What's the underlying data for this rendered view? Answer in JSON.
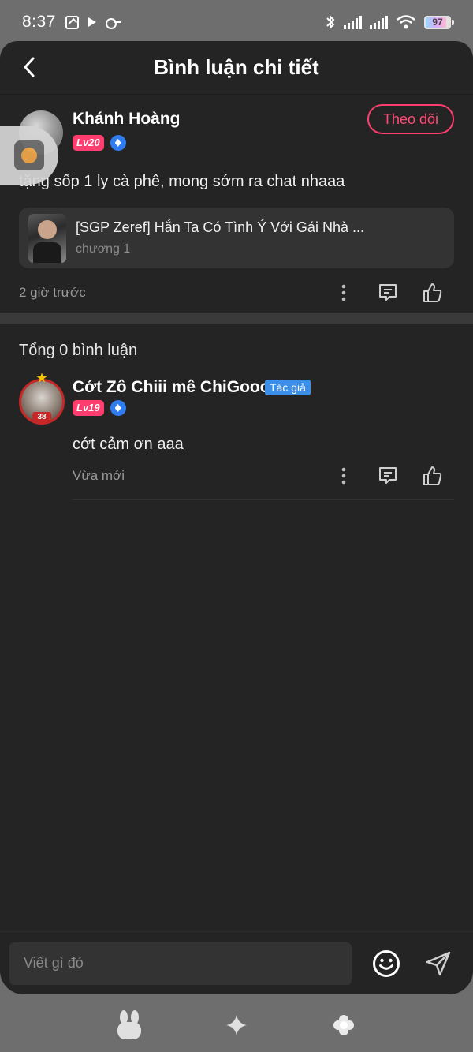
{
  "status_bar": {
    "time": "8:37",
    "battery": "97"
  },
  "header": {
    "title": "Bình luận chi tiết",
    "back_icon": "chevron-left-icon"
  },
  "main_comment": {
    "user_name": "Khánh Hoàng",
    "level": "Lv20",
    "follow_label": "Theo dõi",
    "text": "tặng sốp 1 ly cà phê, mong sớm ra chat nhaaa",
    "story": {
      "title": "[SGP Zeref] Hắn Ta Có Tình Ý Với Gái Nhà ...",
      "chapter": "chương 1"
    },
    "time": "2 giờ trước"
  },
  "replies_section": {
    "total_label": "Tổng 0 bình luận"
  },
  "replies": [
    {
      "user_name": "Cớt Zô Chiii mê ChiGooo",
      "author_tag": "Tác giả",
      "level": "Lv19",
      "avatar_tag": "38",
      "text": "cớt cảm ơn aaa",
      "time": "Vừa mới"
    }
  ],
  "input": {
    "placeholder": "Viết gì đó"
  },
  "colors": {
    "accent": "#ff3d6e",
    "background": "#242424",
    "author_tag": "#3b8fe8"
  }
}
